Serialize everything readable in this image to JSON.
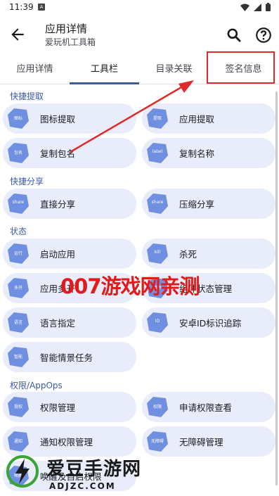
{
  "status_bar": {
    "time": "11:39",
    "notification_glyph": "A",
    "icons": [
      "wifi-icon",
      "signal-icon",
      "battery-icon"
    ]
  },
  "app_bar": {
    "title": "应用详情",
    "subtitle": "爱玩机工具箱"
  },
  "tabs": [
    {
      "label": "应用详情",
      "active": false
    },
    {
      "label": "工具栏",
      "active": true
    },
    {
      "label": "目录关联",
      "active": false
    },
    {
      "label": "签名信息",
      "active": false
    }
  ],
  "sections": [
    {
      "title": "快捷提取",
      "items": [
        {
          "badge": "图标",
          "label": "图标提取"
        },
        {
          "badge": "提取",
          "label": "应用提取"
        },
        {
          "badge": "包名",
          "label": "复制包名"
        },
        {
          "badge": "label",
          "label": "复制名称"
        }
      ]
    },
    {
      "title": "快捷分享",
      "items": [
        {
          "badge": "share",
          "label": "直接分享"
        },
        {
          "badge": "share",
          "label": "压缩分享"
        }
      ]
    },
    {
      "title": "状态",
      "items": [
        {
          "badge": "运行",
          "label": "启动应用"
        },
        {
          "badge": "kill",
          "label": "杀死"
        },
        {
          "badge": "多开",
          "label": "应用多开"
        },
        {
          "badge": "组件",
          "label": "组件状态管理"
        },
        {
          "badge": "语言",
          "label": "语言指定"
        },
        {
          "badge": "ID",
          "label": "安卓ID标识追踪"
        },
        {
          "badge": "智能",
          "label": "智能情景任务"
        }
      ]
    },
    {
      "title": "权限/AppOps",
      "items": [
        {
          "badge": "授权",
          "label": "权限管理"
        },
        {
          "badge": "权限",
          "label": "申请权限查看"
        },
        {
          "badge": "通知",
          "label": "通知权限管理"
        },
        {
          "badge": "无障碍",
          "label": "无障碍管理"
        },
        {
          "badge": "唤醒",
          "label": "唤醒及自启权限"
        }
      ]
    }
  ],
  "overlay": {
    "watermark_text": "007游戏网亲测"
  },
  "footer_watermark": {
    "title": "爱豆手游网",
    "url": "ADJZC.COM"
  },
  "colors": {
    "accent": "#3a5ba9",
    "card_bg": "#e8ecfb",
    "badge": "#6f8fe0",
    "annotation_red": "#e02a2a"
  }
}
